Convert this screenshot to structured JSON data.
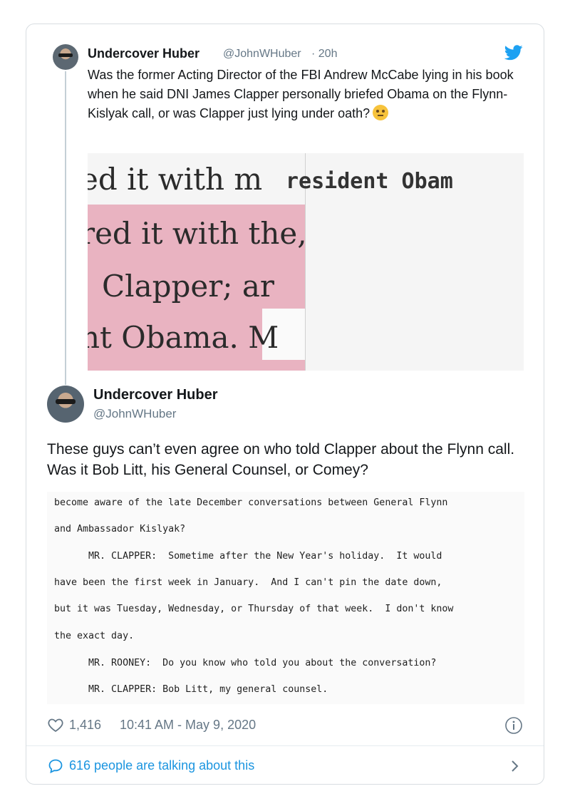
{
  "quoted_tweet": {
    "name": "Undercover Huber",
    "handle": "@JohnWHuber",
    "time": "· 20h",
    "text": "Was the former Acting Director of the FBI Andrew McCabe lying in his book when he said DNI James Clapper personally briefed Obama on the Flynn-Kislyak call, or was Clapper just lying under oath?",
    "emoji_icon": "thinking-face-emoji",
    "image_lines": [
      "ed it with m",
      "resident Obam",
      "red it with the,",
      "Clapper;  ar",
      "nt Obama. M"
    ]
  },
  "main_tweet": {
    "name": "Undercover Huber",
    "handle": "@JohnWHuber",
    "text": "These guys can’t even agree on who told Clapper about the Flynn call. Was it Bob Litt, his General Counsel, or Comey?",
    "transcript_lines": [
      "become aware of the late December conversations between General Flynn",
      "and Ambassador Kislyak?",
      "      MR. CLAPPER:  Sometime after the New Year's holiday.  It would",
      "have been the first week in January.  And I can't pin the date down,",
      "but it was Tuesday, Wednesday, or Thursday of that week.  I don't know",
      "the exact day.",
      "      MR. ROONEY:  Do you know who told you about the conversation?",
      "      MR. CLAPPER: Bob Litt, my general counsel."
    ],
    "likes": "1,416",
    "timestamp": "10:41 AM - May 9, 2020"
  },
  "footer": {
    "talking": "616 people are talking about this"
  },
  "colors": {
    "accent": "#1b95e0",
    "muted": "#657786",
    "highlight": "#e9b3c1"
  }
}
